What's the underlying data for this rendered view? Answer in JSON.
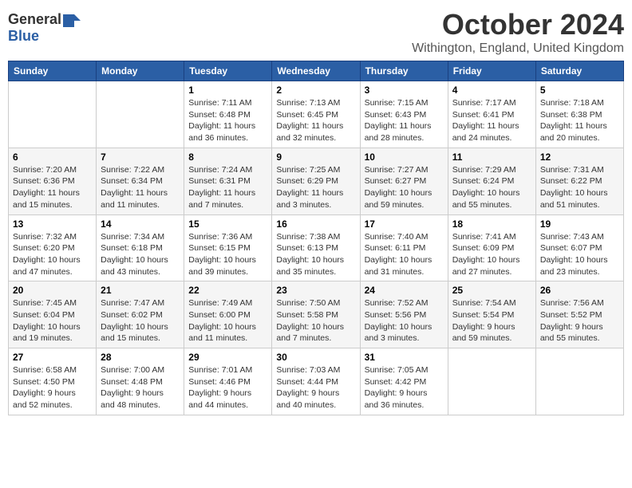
{
  "logo": {
    "general": "General",
    "blue": "Blue"
  },
  "title": "October 2024",
  "location": "Withington, England, United Kingdom",
  "days_of_week": [
    "Sunday",
    "Monday",
    "Tuesday",
    "Wednesday",
    "Thursday",
    "Friday",
    "Saturday"
  ],
  "weeks": [
    [
      {
        "day": "",
        "info": ""
      },
      {
        "day": "",
        "info": ""
      },
      {
        "day": "1",
        "info": "Sunrise: 7:11 AM\nSunset: 6:48 PM\nDaylight: 11 hours and 36 minutes."
      },
      {
        "day": "2",
        "info": "Sunrise: 7:13 AM\nSunset: 6:45 PM\nDaylight: 11 hours and 32 minutes."
      },
      {
        "day": "3",
        "info": "Sunrise: 7:15 AM\nSunset: 6:43 PM\nDaylight: 11 hours and 28 minutes."
      },
      {
        "day": "4",
        "info": "Sunrise: 7:17 AM\nSunset: 6:41 PM\nDaylight: 11 hours and 24 minutes."
      },
      {
        "day": "5",
        "info": "Sunrise: 7:18 AM\nSunset: 6:38 PM\nDaylight: 11 hours and 20 minutes."
      }
    ],
    [
      {
        "day": "6",
        "info": "Sunrise: 7:20 AM\nSunset: 6:36 PM\nDaylight: 11 hours and 15 minutes."
      },
      {
        "day": "7",
        "info": "Sunrise: 7:22 AM\nSunset: 6:34 PM\nDaylight: 11 hours and 11 minutes."
      },
      {
        "day": "8",
        "info": "Sunrise: 7:24 AM\nSunset: 6:31 PM\nDaylight: 11 hours and 7 minutes."
      },
      {
        "day": "9",
        "info": "Sunrise: 7:25 AM\nSunset: 6:29 PM\nDaylight: 11 hours and 3 minutes."
      },
      {
        "day": "10",
        "info": "Sunrise: 7:27 AM\nSunset: 6:27 PM\nDaylight: 10 hours and 59 minutes."
      },
      {
        "day": "11",
        "info": "Sunrise: 7:29 AM\nSunset: 6:24 PM\nDaylight: 10 hours and 55 minutes."
      },
      {
        "day": "12",
        "info": "Sunrise: 7:31 AM\nSunset: 6:22 PM\nDaylight: 10 hours and 51 minutes."
      }
    ],
    [
      {
        "day": "13",
        "info": "Sunrise: 7:32 AM\nSunset: 6:20 PM\nDaylight: 10 hours and 47 minutes."
      },
      {
        "day": "14",
        "info": "Sunrise: 7:34 AM\nSunset: 6:18 PM\nDaylight: 10 hours and 43 minutes."
      },
      {
        "day": "15",
        "info": "Sunrise: 7:36 AM\nSunset: 6:15 PM\nDaylight: 10 hours and 39 minutes."
      },
      {
        "day": "16",
        "info": "Sunrise: 7:38 AM\nSunset: 6:13 PM\nDaylight: 10 hours and 35 minutes."
      },
      {
        "day": "17",
        "info": "Sunrise: 7:40 AM\nSunset: 6:11 PM\nDaylight: 10 hours and 31 minutes."
      },
      {
        "day": "18",
        "info": "Sunrise: 7:41 AM\nSunset: 6:09 PM\nDaylight: 10 hours and 27 minutes."
      },
      {
        "day": "19",
        "info": "Sunrise: 7:43 AM\nSunset: 6:07 PM\nDaylight: 10 hours and 23 minutes."
      }
    ],
    [
      {
        "day": "20",
        "info": "Sunrise: 7:45 AM\nSunset: 6:04 PM\nDaylight: 10 hours and 19 minutes."
      },
      {
        "day": "21",
        "info": "Sunrise: 7:47 AM\nSunset: 6:02 PM\nDaylight: 10 hours and 15 minutes."
      },
      {
        "day": "22",
        "info": "Sunrise: 7:49 AM\nSunset: 6:00 PM\nDaylight: 10 hours and 11 minutes."
      },
      {
        "day": "23",
        "info": "Sunrise: 7:50 AM\nSunset: 5:58 PM\nDaylight: 10 hours and 7 minutes."
      },
      {
        "day": "24",
        "info": "Sunrise: 7:52 AM\nSunset: 5:56 PM\nDaylight: 10 hours and 3 minutes."
      },
      {
        "day": "25",
        "info": "Sunrise: 7:54 AM\nSunset: 5:54 PM\nDaylight: 9 hours and 59 minutes."
      },
      {
        "day": "26",
        "info": "Sunrise: 7:56 AM\nSunset: 5:52 PM\nDaylight: 9 hours and 55 minutes."
      }
    ],
    [
      {
        "day": "27",
        "info": "Sunrise: 6:58 AM\nSunset: 4:50 PM\nDaylight: 9 hours and 52 minutes."
      },
      {
        "day": "28",
        "info": "Sunrise: 7:00 AM\nSunset: 4:48 PM\nDaylight: 9 hours and 48 minutes."
      },
      {
        "day": "29",
        "info": "Sunrise: 7:01 AM\nSunset: 4:46 PM\nDaylight: 9 hours and 44 minutes."
      },
      {
        "day": "30",
        "info": "Sunrise: 7:03 AM\nSunset: 4:44 PM\nDaylight: 9 hours and 40 minutes."
      },
      {
        "day": "31",
        "info": "Sunrise: 7:05 AM\nSunset: 4:42 PM\nDaylight: 9 hours and 36 minutes."
      },
      {
        "day": "",
        "info": ""
      },
      {
        "day": "",
        "info": ""
      }
    ]
  ]
}
